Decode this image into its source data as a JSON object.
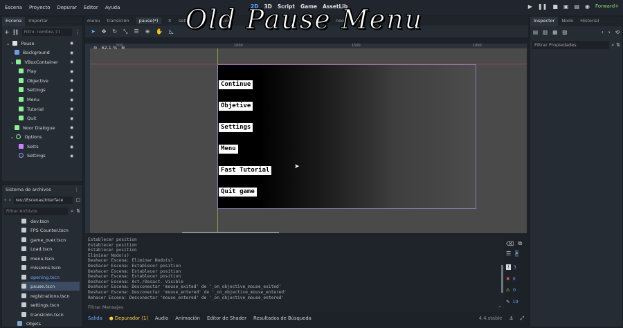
{
  "overlay_title": "Old Pause Menu",
  "menubar": {
    "items": [
      "Escena",
      "Proyecto",
      "Depurar",
      "Editor",
      "Ayuda"
    ],
    "tools": [
      "2D",
      "3D",
      "Script",
      "Game",
      "AssetLib"
    ],
    "renderer": "Forward+"
  },
  "scene_tabs": {
    "items": [
      "menu",
      "transición",
      "pause(*)",
      "sett",
      "over",
      "noor",
      "droff"
    ]
  },
  "scene_panel": {
    "tabs": [
      "Escena",
      "Importar"
    ],
    "filter_placeholder": "Filtro: nombre, t:t",
    "nodes": [
      {
        "label": "Pause",
        "color": "#e0e0e0"
      },
      {
        "label": "Background",
        "color": "#6f9be8"
      },
      {
        "label": "VBoxContainer",
        "color": "#8eef97"
      },
      {
        "label": "Play",
        "color": "#8eef97"
      },
      {
        "label": "Objective",
        "color": "#8eef97"
      },
      {
        "label": "Settings",
        "color": "#8eef97"
      },
      {
        "label": "Menu",
        "color": "#8eef97"
      },
      {
        "label": "Tutorial",
        "color": "#8eef97"
      },
      {
        "label": "Quit",
        "color": "#8eef97"
      },
      {
        "label": "Noor Dialogue",
        "color": "#8eef97"
      },
      {
        "label": "Options",
        "color": "#8eef97"
      },
      {
        "label": "Setts",
        "color": "#c782ff"
      },
      {
        "label": "Settings",
        "color": "#8da5f3"
      }
    ]
  },
  "filesystem": {
    "title": "Sistema de archivos",
    "path": "res://Escenas/Interface",
    "filter_placeholder": "Filtrar Archivos",
    "files": [
      "dev.tscn",
      "FPS Counter.tscn",
      "game_over.tscn",
      "Load.tscn",
      "menu.tscn",
      "missions.tscn",
      "opening.tscn",
      "pause.tscn",
      "registrations.tscn",
      "settings.tscn",
      "transición.tscn",
      "Objets"
    ],
    "selected": "pause.tscn"
  },
  "viewport": {
    "zoom": "62.1 %",
    "ruler_marks": [
      "500",
      "1000",
      "1500",
      "1000"
    ],
    "pause_buttons": [
      "Continue",
      "Objetive",
      "Settings",
      "Menu",
      "Fast Tutorial",
      "Quit game"
    ]
  },
  "output_log": {
    "lines": [
      "Establecer position",
      "Establecer position",
      "Establecer position",
      "Eliminar Nodo(s)",
      "Deshacer Escena: Eliminar Nodo(s)",
      "Deshacer Escena: Establecer position",
      "Deshacer Escena: Establecer position",
      "Deshacer Escena: Establecer position",
      "Deshacer Escena: Act./Desact. Visible",
      "Deshacer Escena: Desconectar 'mouse_exited' de '_on_objective_mouse_exited'",
      "Deshacer Escena: Desconectar 'mouse_entered' de '_on_objective_mouse_entered'",
      "Rehacer Escena: Desconectar 'mouse_entered' de '_on_objective_mouse_entered'"
    ],
    "filter_placeholder": "Filtrar Mensajes",
    "counts": {
      "messages": "3",
      "errors": "0",
      "warnings": "0",
      "info": "19"
    }
  },
  "bottom_tabs": {
    "items": [
      "Salida",
      "Depurador (1)",
      "Audio",
      "Animación",
      "Editor de Shader",
      "Resultados de Búsqueda"
    ],
    "version": "4.4.stable"
  },
  "inspector": {
    "tabs": [
      "Inspector",
      "Nodo",
      "Historial"
    ],
    "filter_placeholder": "Filtrar Propiedades"
  }
}
